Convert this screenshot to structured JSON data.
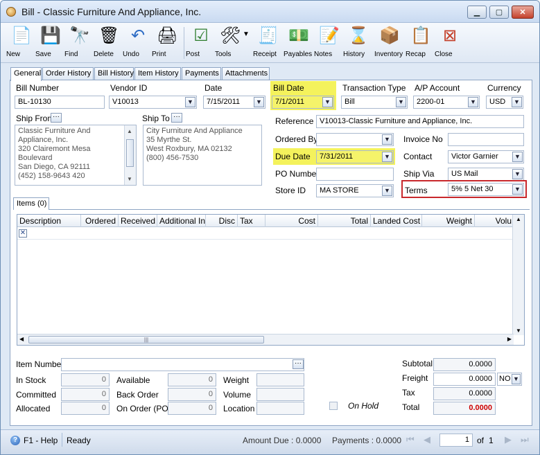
{
  "window": {
    "title": "Bill - Classic Furniture And Appliance, Inc."
  },
  "toolbar": {
    "items": [
      {
        "label": "New",
        "icon": "new-document-icon"
      },
      {
        "label": "Save",
        "icon": "floppy-disk-icon"
      },
      {
        "label": "Find",
        "icon": "binoculars-icon"
      },
      {
        "label": "Delete",
        "icon": "trash-can-icon"
      },
      {
        "label": "Undo",
        "icon": "undo-arrow-icon"
      },
      {
        "label": "Print",
        "icon": "printer-icon"
      },
      {
        "label": "Post",
        "icon": "post-checklist-icon"
      },
      {
        "label": "Tools",
        "icon": "tools-icon"
      },
      {
        "label": "Receipt",
        "icon": "receipt-icon"
      },
      {
        "label": "Payables",
        "icon": "payables-icon"
      },
      {
        "label": "Notes",
        "icon": "notes-pen-icon"
      },
      {
        "label": "History",
        "icon": "history-icon"
      },
      {
        "label": "Inventory",
        "icon": "inventory-boxes-icon"
      },
      {
        "label": "Recap",
        "icon": "recap-icon"
      },
      {
        "label": "Close",
        "icon": "close-door-icon"
      }
    ]
  },
  "tabs": [
    "General",
    "Order History",
    "Bill History",
    "Item History",
    "Payments",
    "Attachments"
  ],
  "header": {
    "bill_number_label": "Bill Number",
    "bill_number": "BL-10130",
    "vendor_id_label": "Vendor ID",
    "vendor_id": "V10013",
    "date_label": "Date",
    "date": "7/15/2011",
    "bill_date_label": "Bill Date",
    "bill_date": "7/1/2011",
    "transaction_type_label": "Transaction Type",
    "transaction_type": "Bill",
    "ap_account_label": "A/P Account",
    "ap_account": "2200-01",
    "currency_label": "Currency",
    "currency": "USD"
  },
  "ship_from": {
    "label": "Ship From",
    "lines": [
      "Classic Furniture And",
      "Appliance, Inc.",
      "320 Clairemont Mesa",
      "Boulevard",
      "San Diego, CA 92111",
      "(452) 158-9643 420"
    ]
  },
  "ship_to": {
    "label": "Ship To",
    "lines": [
      "City Furniture And Appliance",
      "35 Myrthe St.",
      "West Roxbury, MA 02132",
      "(800) 456-7530"
    ]
  },
  "details": {
    "reference_label": "Reference",
    "reference": "V10013-Classic Furniture and Appliance, Inc.",
    "ordered_by_label": "Ordered By",
    "ordered_by": "",
    "invoice_no_label": "Invoice No",
    "invoice_no": "",
    "due_date_label": "Due Date",
    "due_date": "7/31/2011",
    "contact_label": "Contact",
    "contact": "Victor Garnier",
    "po_number_label": "PO Number",
    "po_number": "",
    "ship_via_label": "Ship Via",
    "ship_via": "US Mail",
    "store_id_label": "Store ID",
    "store_id": "MA STORE",
    "terms_label": "Terms",
    "terms": "5% 5 Net 30"
  },
  "items": {
    "tab_label": "Items (0)",
    "columns": [
      "Description",
      "Ordered",
      "Received",
      "Additional Inf",
      "Disc",
      "Tax",
      "Cost",
      "Total",
      "Landed Cost",
      "Weight",
      "Volu"
    ]
  },
  "footer": {
    "item_number_label": "Item Number",
    "in_stock_label": "In Stock",
    "in_stock": "0",
    "available_label": "Available",
    "available": "0",
    "weight_label": "Weight",
    "committed_label": "Committed",
    "committed": "0",
    "back_order_label": "Back Order",
    "back_order": "0",
    "volume_label": "Volume",
    "allocated_label": "Allocated",
    "allocated": "0",
    "on_order_label": "On Order (PO)",
    "on_order": "0",
    "location_label": "Location",
    "on_hold_label": "On Hold",
    "subtotal_label": "Subtotal",
    "subtotal": "0.0000",
    "freight_label": "Freight",
    "freight": "0.0000",
    "freight_flag": "NO",
    "tax_label": "Tax",
    "tax": "0.0000",
    "total_label": "Total",
    "total": "0.0000"
  },
  "status": {
    "help": "F1 - Help",
    "state": "Ready",
    "amount_due": "Amount Due : 0.0000",
    "payments": "Payments : 0.0000",
    "page": "1",
    "of": "of",
    "total_pages": "1"
  }
}
